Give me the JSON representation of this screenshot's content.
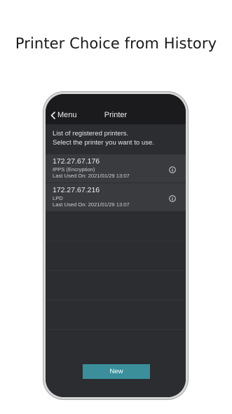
{
  "headline": "Printer Choice from History",
  "nav": {
    "back_label": "Menu",
    "title": "Printer"
  },
  "intro": {
    "line1": "List of registered printers.",
    "line2": "Select the printer you want to use."
  },
  "printers": [
    {
      "ip": "172.27.67.176",
      "protocol": "IPPS (Encryption)",
      "last_used": "Last Used On: 2021/01/29 13:07"
    },
    {
      "ip": "172.27.67.216",
      "protocol": "LPD",
      "last_used": "Last Used On: 2021/01/29 13:07"
    }
  ],
  "new_button_label": "New",
  "colors": {
    "accent_button": "#3a8f9b",
    "screen_bg": "#2c2d30",
    "row_bg": "#3a3b3f"
  },
  "icons": {
    "back": "chevron-left-icon",
    "info": "info-icon"
  }
}
